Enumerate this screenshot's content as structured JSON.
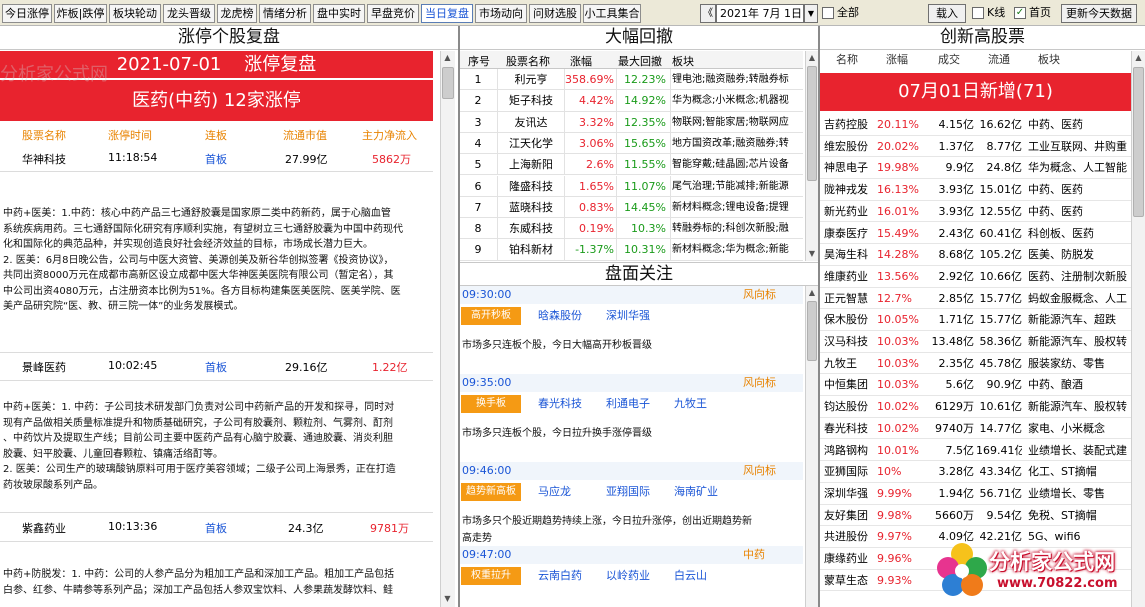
{
  "toolbar": {
    "tabs": [
      {
        "label": "今日涨停"
      },
      {
        "label": "炸板|跌停"
      },
      {
        "label": "板块轮动"
      },
      {
        "label": "龙头晋级"
      },
      {
        "label": "龙虎榜"
      },
      {
        "label": "情绪分析"
      },
      {
        "label": "盘中实时"
      },
      {
        "label": "早盘竞价"
      },
      {
        "label": "当日复盘"
      },
      {
        "label": "市场动向"
      },
      {
        "label": "问财选股"
      },
      {
        "label": "小工具集合"
      }
    ],
    "active_tab": "当日复盘",
    "date_value": "2021年 7月 1日",
    "nav_prev": "《",
    "nav_dropdown": "▼",
    "all_label": "全部",
    "load_button": "载入",
    "kline_label": "K线",
    "homepage_label": "首页",
    "update_button": "更新今天数据"
  },
  "left": {
    "title": "涨停个股复盘",
    "banner_date": "2021-07-01",
    "banner_suffix": "涨停复盘",
    "sector_title": "医药(中药)  12家涨停",
    "watermark": "分析家公式网",
    "columns": [
      "股票名称",
      "涨停时间",
      "连板",
      "流通市值",
      "主力净流入"
    ],
    "stocks": [
      {
        "name": "华神科技",
        "time": "11:18:54",
        "board": "首板",
        "mktcap": "27.99亿",
        "inflow": "5862万",
        "desc": "中药+医美：1.中药：核心中药产品三七通舒胶囊是国家原二类中药新药，属于心脑血管\n系统疾病用药。三七通舒国际化研究有序顺利实施，有望树立三七通舒胶囊为中国中药现代\n化和国际化的典范品种，并实现创造良好社会经济效益的目标，市场成长潜力巨大。\n2. 医美：6月8日晚公告，公司与中医大资管、美源创美及新谷华创拟签署《投资协议》，\n共同出资8000万元在成都市高新区设立成都中医大华神医美医院有限公司（暂定名），其\n中公司出资4080万元，占注册资本比例为51%。各方目标构建集医美医院、医美学院、医\n美产品研究院“医、教、研三院一体”的业务发展模式。"
      },
      {
        "name": "景峰医药",
        "time": "10:02:45",
        "board": "首板",
        "mktcap": "29.16亿",
        "inflow": "1.22亿",
        "desc": "中药+医美：1. 中药：子公司技术研发部门负责对公司中药新产品的开发和探寻，同时对\n现有产品做相关质量标准提升和物质基础研究，子公司有胶囊剂、颗粒剂、气雾剂、酊剂\n、中药饮片及提取生产线；目前公司主要中医药产品有心脑宁胶囊、通迪胶囊、消炎利胆\n胶囊、妇平胶囊、儿童回春颗粒、镇痛活络酊等。\n2. 医美：公司生产的玻璃酸钠原料可用于医疗美容领域；二级子公司上海景秀，正在打造\n药妆玻尿酸系列产品。"
      },
      {
        "name": "紫鑫药业",
        "time": "10:13:36",
        "board": "首板",
        "mktcap": "24.3亿",
        "inflow": "9781万",
        "desc": "中药+防脱发：1. 中药：公司的人参产品分为粗加工产品和深加工产品。粗加工产品包括\n白参、红参、牛睛参等系列产品；深加工产品包括人参双宝饮料、人参果蔬发酵饮料、鲑"
      }
    ]
  },
  "middle": {
    "title": "大幅回撤",
    "columns": [
      "序号",
      "股票名称",
      "涨幅",
      "最大回撤",
      "板块"
    ],
    "rows": [
      {
        "no": "1",
        "name": "利元亨",
        "chg": "358.69%",
        "dd": "12.23%",
        "sector": "锂电池;融资融券;转融券标"
      },
      {
        "no": "2",
        "name": "矩子科技",
        "chg": "4.42%",
        "dd": "14.92%",
        "sector": "华为概念;小米概念;机器视"
      },
      {
        "no": "3",
        "name": "友讯达",
        "chg": "3.32%",
        "dd": "12.35%",
        "sector": "物联网;智能家居;物联网应"
      },
      {
        "no": "4",
        "name": "江天化学",
        "chg": "3.06%",
        "dd": "15.65%",
        "sector": "地方国资改革;融资融券;转"
      },
      {
        "no": "5",
        "name": "上海新阳",
        "chg": "2.6%",
        "dd": "11.55%",
        "sector": "智能穿戴;硅晶圆;芯片设备"
      },
      {
        "no": "6",
        "name": "隆盛科技",
        "chg": "1.65%",
        "dd": "11.07%",
        "sector": "尾气治理;节能减排;新能源"
      },
      {
        "no": "7",
        "name": "蓝晓科技",
        "chg": "0.83%",
        "dd": "14.45%",
        "sector": "新材料概念;锂电设备;提锂"
      },
      {
        "no": "8",
        "name": "东威科技",
        "chg": "0.19%",
        "dd": "10.3%",
        "sector": "转融券标的;科创次新股;融"
      },
      {
        "no": "9",
        "name": "铂科新材",
        "chg": "-1.37%",
        "dd": "10.31%",
        "sector": "新材料概念;华为概念;新能"
      }
    ],
    "focus_title": "盘面关注",
    "focus": [
      {
        "time": "09:30:00",
        "level": "风向标",
        "tag": "高开秒板",
        "stocks": [
          "晗森股份",
          "深圳华强"
        ],
        "text": "市场多只连板个股，今日大幅高开秒板晋级"
      },
      {
        "time": "09:35:00",
        "level": "风向标",
        "tag": "换手板",
        "stocks": [
          "春光科技",
          "利通电子",
          "九牧王"
        ],
        "text": "市场多只连板个股，今日拉升换手涨停晋级"
      },
      {
        "time": "09:46:00",
        "level": "风向标",
        "tag": "趋势新高板",
        "stocks": [
          "马应龙",
          "亚翔国际",
          "海南矿业"
        ],
        "text": "市场多只个股近期趋势持续上涨，今日拉升涨停，创出近期趋势新\n高走势"
      },
      {
        "time": "09:47:00",
        "level": "中药",
        "tag": "权重拉升",
        "stocks": [
          "云南白药",
          "以岭药业",
          "白云山"
        ],
        "text": ""
      }
    ]
  },
  "right": {
    "title": "创新高股票",
    "columns": [
      "名称",
      "涨幅",
      "成交",
      "流通",
      "板块"
    ],
    "banner": "07月01日新增(71)",
    "rows": [
      {
        "name": "吉药控股",
        "chg": "20.11%",
        "vol": "4.15亿",
        "cap": "16.62亿",
        "sector": "中药、医药"
      },
      {
        "name": "维宏股份",
        "chg": "20.02%",
        "vol": "1.37亿",
        "cap": "8.77亿",
        "sector": "工业互联网、井购重"
      },
      {
        "name": "神思电子",
        "chg": "19.98%",
        "vol": "9.9亿",
        "cap": "24.8亿",
        "sector": "华为概念、人工智能"
      },
      {
        "name": "陇神戎发",
        "chg": "16.13%",
        "vol": "3.93亿",
        "cap": "15.01亿",
        "sector": "中药、医药"
      },
      {
        "name": "新光药业",
        "chg": "16.01%",
        "vol": "3.93亿",
        "cap": "12.55亿",
        "sector": "中药、医药"
      },
      {
        "name": "康泰医疗",
        "chg": "15.49%",
        "vol": "2.43亿",
        "cap": "60.41亿",
        "sector": "科创板、医药"
      },
      {
        "name": "昊海生科",
        "chg": "14.28%",
        "vol": "8.68亿",
        "cap": "105.2亿",
        "sector": "医美、防脱发"
      },
      {
        "name": "维康药业",
        "chg": "13.56%",
        "vol": "2.92亿",
        "cap": "10.66亿",
        "sector": "医药、注册制次新股"
      },
      {
        "name": "正元智慧",
        "chg": "12.7%",
        "vol": "2.85亿",
        "cap": "15.77亿",
        "sector": "蚂蚁金服概念、人工"
      },
      {
        "name": "保木股份",
        "chg": "10.05%",
        "vol": "1.71亿",
        "cap": "15.77亿",
        "sector": "新能源汽车、超跌"
      },
      {
        "name": "汉马科技",
        "chg": "10.03%",
        "vol": "13.48亿",
        "cap": "58.36亿",
        "sector": "新能源汽车、股权转"
      },
      {
        "name": "九牧王",
        "chg": "10.03%",
        "vol": "2.35亿",
        "cap": "45.78亿",
        "sector": "服装家纺、零售"
      },
      {
        "name": "中恒集团",
        "chg": "10.03%",
        "vol": "5.6亿",
        "cap": "90.9亿",
        "sector": "中药、酿酒"
      },
      {
        "name": "钧达股份",
        "chg": "10.02%",
        "vol": "6129万",
        "cap": "10.61亿",
        "sector": "新能源汽车、股权转"
      },
      {
        "name": "春光科技",
        "chg": "10.02%",
        "vol": "9740万",
        "cap": "14.77亿",
        "sector": "家电、小米概念"
      },
      {
        "name": "鸿路钢构",
        "chg": "10.01%",
        "vol": "7.5亿",
        "cap": "169.41亿",
        "sector": "业绩增长、装配式建"
      },
      {
        "name": "亚狮国际",
        "chg": "10%",
        "vol": "3.28亿",
        "cap": "43.34亿",
        "sector": "化工、ST摘帽"
      },
      {
        "name": "深圳华强",
        "chg": "9.99%",
        "vol": "1.94亿",
        "cap": "56.71亿",
        "sector": "业绩增长、零售"
      },
      {
        "name": "友好集团",
        "chg": "9.98%",
        "vol": "5660万",
        "cap": "9.54亿",
        "sector": "免税、ST摘帽"
      },
      {
        "name": "共进股份",
        "chg": "9.97%",
        "vol": "4.09亿",
        "cap": "42.21亿",
        "sector": "5G、wifi6"
      },
      {
        "name": "康缘药业",
        "chg": "9.96%",
        "vol": "",
        "cap": "",
        "sector": ""
      },
      {
        "name": "蒙草生态",
        "chg": "9.93%",
        "vol": "",
        "cap": "",
        "sector": ""
      }
    ]
  },
  "logo": {
    "name": "分析家公式网",
    "url": "www.70822.com"
  }
}
